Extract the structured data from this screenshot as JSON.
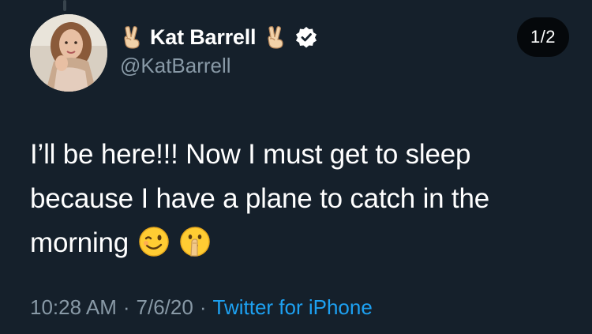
{
  "author": {
    "display_name": "Kat Barrell",
    "handle": "@KatBarrell",
    "verified": true,
    "name_emoji": "victory-hand-emoji"
  },
  "thread_indicator": "1/2",
  "tweet": {
    "line1": "I’ll be here!!! Now I must get to sleep",
    "line2": "because I have a plane to catch in the",
    "line3": "morning",
    "emojis": [
      "winking-face-emoji",
      "shushing-face-emoji"
    ]
  },
  "meta": {
    "time": "10:28 AM",
    "date": "7/6/20",
    "source": "Twitter for iPhone",
    "separator": "·"
  },
  "colors": {
    "background": "#15202b",
    "text": "#ffffff",
    "secondary": "#8899a6",
    "link": "#1da1f2",
    "verified": "#ffffff"
  }
}
